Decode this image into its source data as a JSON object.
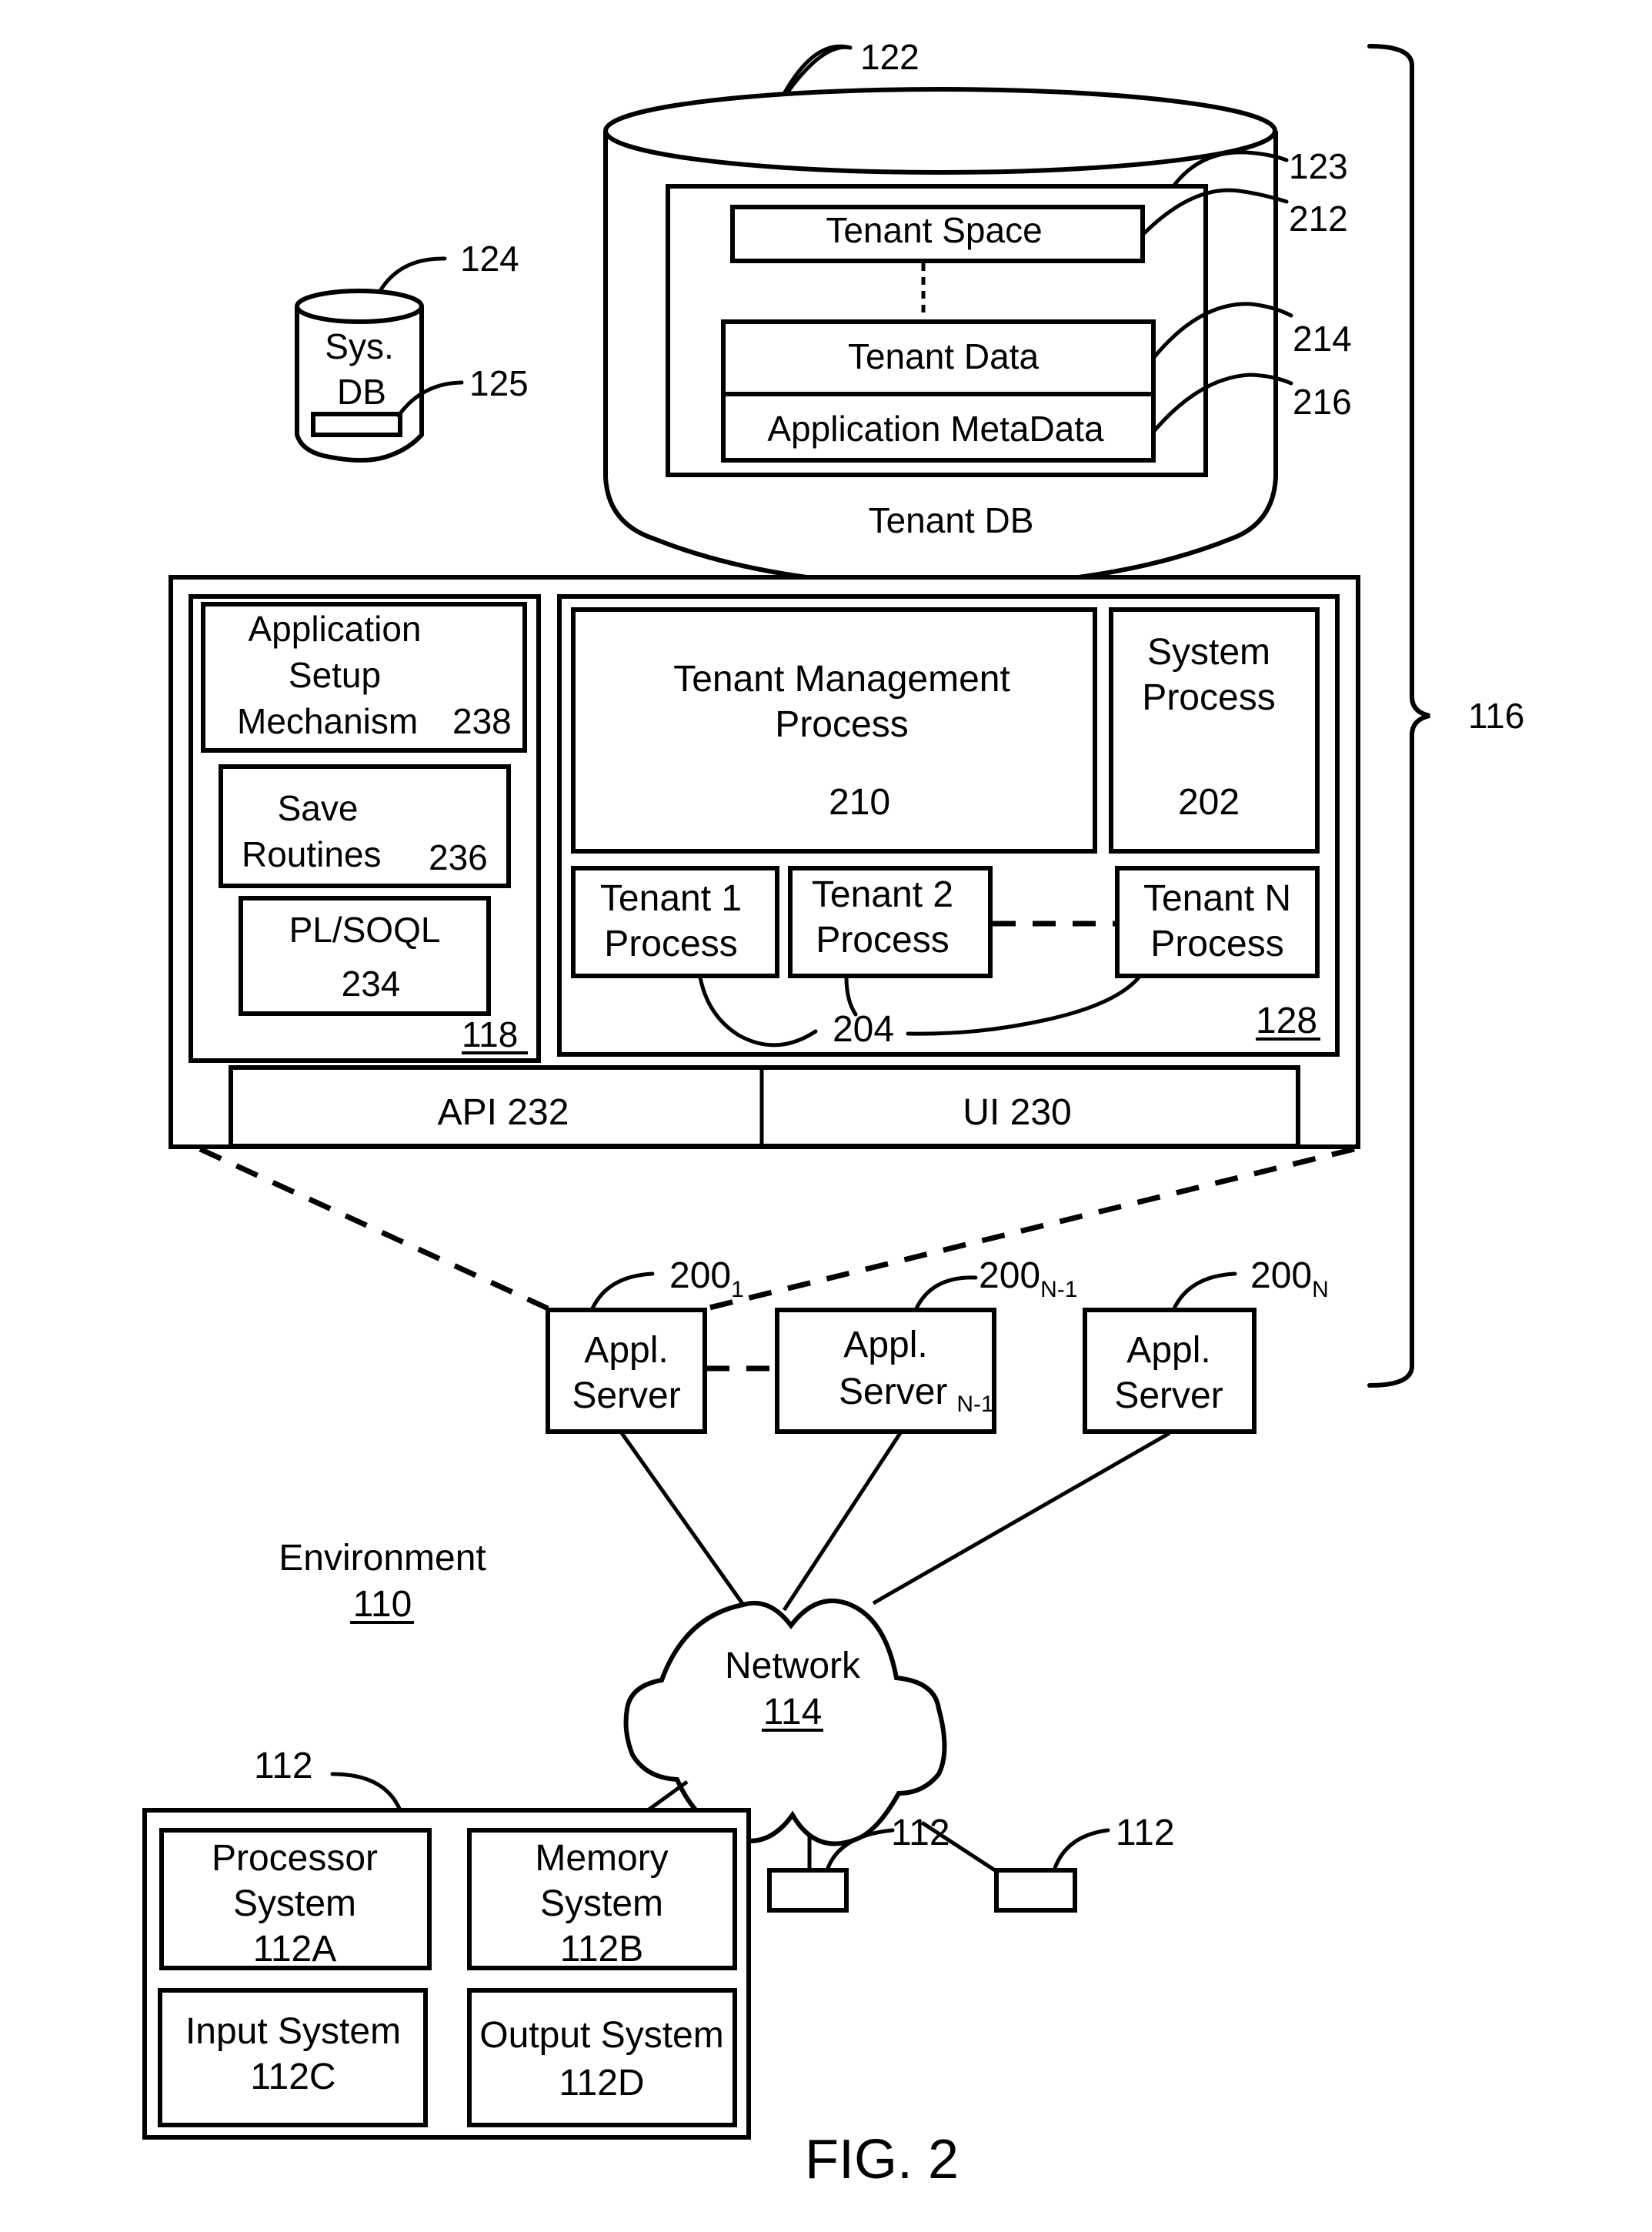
{
  "figure": {
    "caption": "FIG. 2",
    "system_ref": "116",
    "environment": {
      "label": "Environment",
      "ref": "110"
    }
  },
  "tenant_db": {
    "ref": "122",
    "label": "Tenant DB",
    "inner_ref": "123",
    "tenant_space": {
      "label": "Tenant Space",
      "ref": "212"
    },
    "tenant_data": {
      "label": "Tenant Data",
      "ref": "214"
    },
    "app_metadata": {
      "label": "Application MetaData",
      "ref": "216"
    }
  },
  "sys_db": {
    "ref": "124",
    "line1": "Sys.",
    "line2": "DB",
    "inner_ref": "125"
  },
  "app_server_detail": {
    "left_panel": {
      "ref": "118",
      "setup": {
        "line1": "Application",
        "line2": "Setup",
        "line3": "Mechanism",
        "ref": "238"
      },
      "save": {
        "line1": "Save",
        "line2": "Routines",
        "ref": "236"
      },
      "plsoql": {
        "line1": "PL/SOQL",
        "ref": "234"
      }
    },
    "right_panel": {
      "ref": "128",
      "tenant_mgmt": {
        "line1": "Tenant Management",
        "line2": "Process",
        "ref": "210"
      },
      "system_process": {
        "line1": "System",
        "line2": "Process",
        "ref": "202"
      },
      "tenant1": {
        "line1": "Tenant 1",
        "line2": "Process"
      },
      "tenant2": {
        "line1": "Tenant 2",
        "line2": "Process"
      },
      "tenantN": {
        "line1": "Tenant N",
        "line2": "Process"
      },
      "tenant_group_ref": "204"
    },
    "api": "API 232",
    "ui": "UI 230"
  },
  "app_servers": [
    {
      "line1": "Appl.",
      "line2": "Server",
      "suffix": "",
      "ref": "200",
      "ref_sub": "1"
    },
    {
      "line1": "Appl.",
      "line2": "Server",
      "suffix": "N-1",
      "ref": "200",
      "ref_sub": "N-1"
    },
    {
      "line1": "Appl.",
      "line2": "Server",
      "suffix": "",
      "ref": "200",
      "ref_sub": "N"
    }
  ],
  "network": {
    "label": "Network",
    "ref": "114"
  },
  "user_system": {
    "ref": "112",
    "processor": {
      "line1": "Processor",
      "line2": "System",
      "ref": "112A"
    },
    "memory": {
      "line1": "Memory",
      "line2": "System",
      "ref": "112B"
    },
    "input": {
      "line1": "Input System",
      "ref": "112C"
    },
    "output": {
      "line1": "Output System",
      "ref": "112D"
    }
  },
  "other_user_systems": [
    {
      "ref": "112"
    },
    {
      "ref": "112"
    }
  ]
}
